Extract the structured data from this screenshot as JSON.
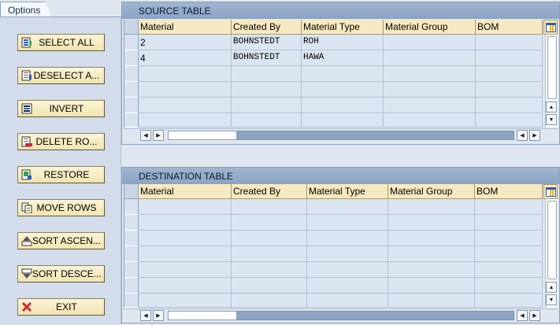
{
  "options": {
    "tab_label": "Options",
    "buttons": [
      {
        "label": "SELECT ALL",
        "icon": "select-all-icon"
      },
      {
        "label": "DESELECT A...",
        "icon": "deselect-all-icon"
      },
      {
        "label": "INVERT",
        "icon": "invert-icon"
      },
      {
        "label": "DELETE RO...",
        "icon": "delete-rows-icon"
      },
      {
        "label": "RESTORE",
        "icon": "restore-icon"
      },
      {
        "label": "MOVE ROWS",
        "icon": "move-rows-icon"
      },
      {
        "label": "SORT ASCEN...",
        "icon": "sort-ascending-icon"
      },
      {
        "label": "SORT DESCE...",
        "icon": "sort-descending-icon"
      },
      {
        "label": "EXIT",
        "icon": "exit-icon"
      }
    ]
  },
  "source_table": {
    "title": "SOURCE TABLE",
    "columns": [
      "Material",
      "Created By",
      "Material Type",
      "Material Group",
      "BOM"
    ],
    "rows": [
      [
        "2",
        "BOHNSTEDT",
        "ROH",
        "",
        ""
      ],
      [
        "4",
        "BOHNSTEDT",
        "HAWA",
        "",
        ""
      ]
    ]
  },
  "destination_table": {
    "title": "DESTINATION TABLE",
    "columns": [
      "Material",
      "Created By",
      "Material Type",
      "Material Group",
      "BOM"
    ],
    "rows": []
  },
  "colors": {
    "title_bar": "#9fb4cf",
    "header_bg": "#f6e9c1",
    "button_bg": "#f1e4b0",
    "exit_icon": "#d8252e"
  }
}
